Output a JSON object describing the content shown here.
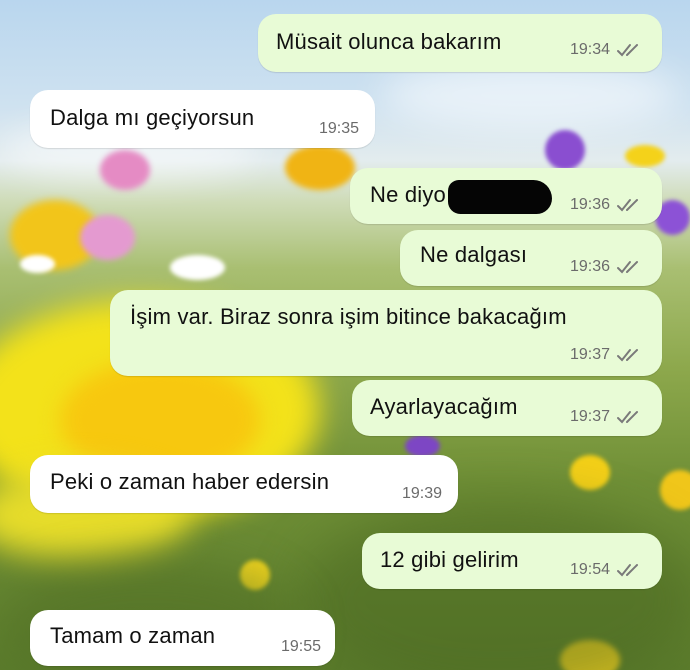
{
  "chat": {
    "messages": [
      {
        "direction": "outgoing",
        "text": "Müsait olunca bakarım",
        "time": "19:34",
        "status_icon": "double-check-icon"
      },
      {
        "direction": "incoming",
        "text": "Dalga mı geçiyorsun",
        "time": "19:35"
      },
      {
        "direction": "outgoing",
        "text": "Ne diyo",
        "time": "19:36",
        "status_icon": "double-check-icon"
      },
      {
        "direction": "outgoing",
        "text": "Ne dalgası",
        "time": "19:36",
        "status_icon": "double-check-icon"
      },
      {
        "direction": "outgoing",
        "text": "İşim var. Biraz sonra işim bitince bakacağım",
        "time": "19:37",
        "status_icon": "double-check-icon"
      },
      {
        "direction": "outgoing",
        "text": "Ayarlayacağım",
        "time": "19:37",
        "status_icon": "double-check-icon"
      },
      {
        "direction": "incoming",
        "text": "Peki o zaman haber edersin",
        "time": "19:39"
      },
      {
        "direction": "outgoing",
        "text": "12 gibi gelirim",
        "time": "19:54",
        "status_icon": "double-check-icon"
      },
      {
        "direction": "incoming",
        "text": "Tamam o zaman",
        "time": "19:55"
      }
    ]
  },
  "colors": {
    "outgoing_bubble": "#e8fbd6",
    "incoming_bubble": "#ffffff",
    "timestamp": "#6b6b6b",
    "ticks": "#7a7a7a"
  }
}
